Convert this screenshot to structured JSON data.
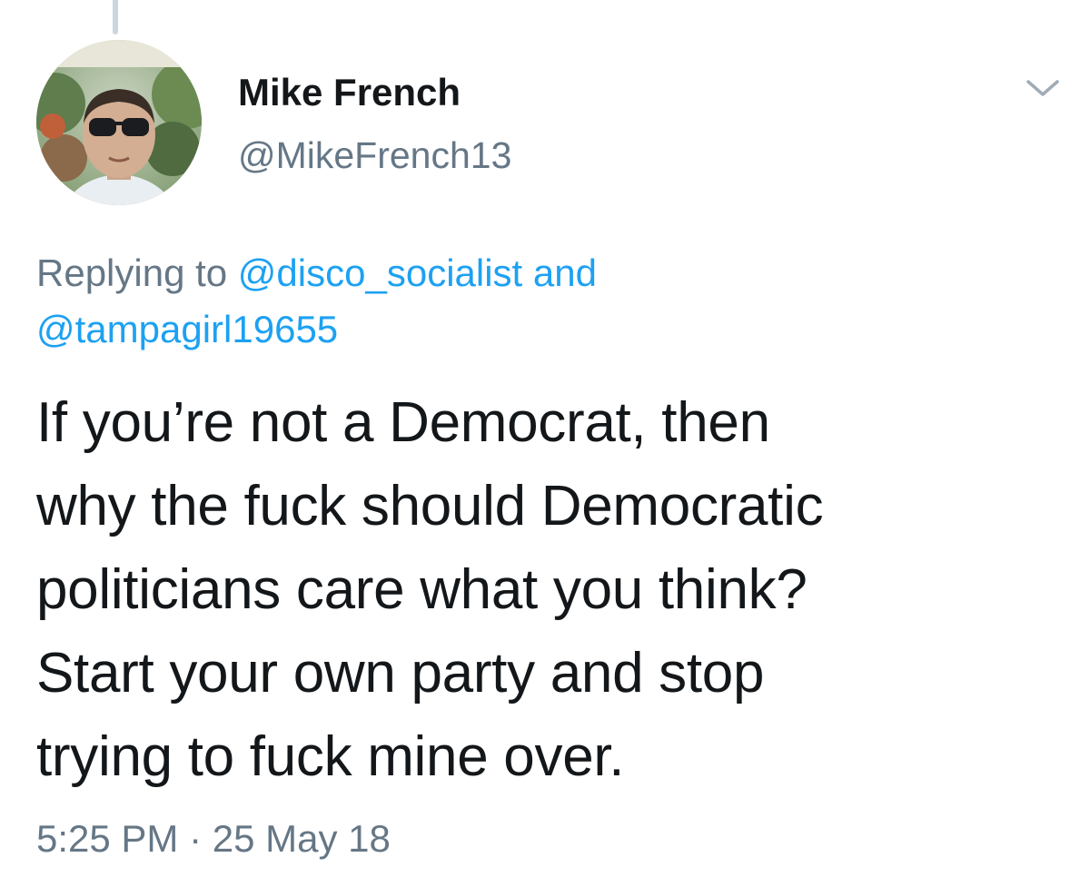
{
  "tweet": {
    "author": {
      "display_name": "Mike French",
      "handle": "@MikeFrench13",
      "avatar_icon": "profile-photo"
    },
    "reply": {
      "prefix": "Replying to ",
      "mention_1": "@disco_socialist",
      "conjunction": " and",
      "mention_2": "@tampagirl19655"
    },
    "text": "If you’re not a Democrat, then\nwhy the fuck should Democratic\npoliticians care what you think?\nStart your own party and stop\ntrying to fuck mine over.",
    "timestamp": "5:25 PM · 25 May 18",
    "menu_icon": "chevron-down-icon"
  },
  "colors": {
    "text_primary": "#14171a",
    "text_secondary": "#657786",
    "link": "#1da1f2",
    "thread_line": "#ccd6dd"
  }
}
